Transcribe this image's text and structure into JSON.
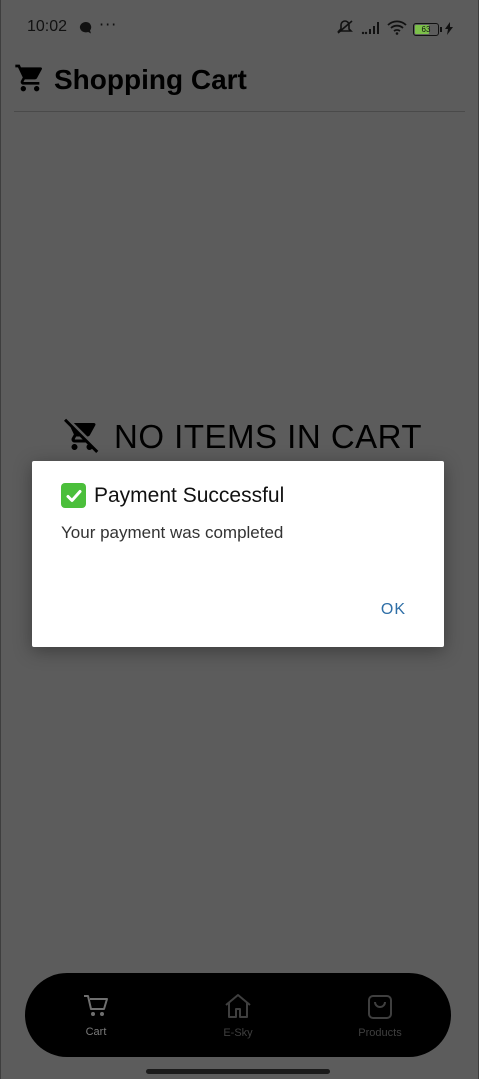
{
  "status_bar": {
    "time": "10:02",
    "more": "···",
    "battery": "63",
    "battery_level": 0.63
  },
  "header": {
    "title": "Shopping Cart"
  },
  "empty_state": {
    "message": "NO ITEMS IN CART"
  },
  "dialog": {
    "title": "Payment Successful",
    "message": "Your payment was completed",
    "ok_label": "OK"
  },
  "bottom_nav": {
    "items": [
      {
        "label": "Cart",
        "icon": "cart-icon",
        "active": true
      },
      {
        "label": "E-Sky",
        "icon": "home-icon",
        "active": false
      },
      {
        "label": "Products",
        "icon": "bag-icon",
        "active": false
      }
    ]
  },
  "colors": {
    "scrim": "#5c5c5c",
    "dialog_bg": "#ffffff",
    "accent": "#2f6fa7",
    "check": "#4bbf3b",
    "nav_bg": "#000000"
  }
}
